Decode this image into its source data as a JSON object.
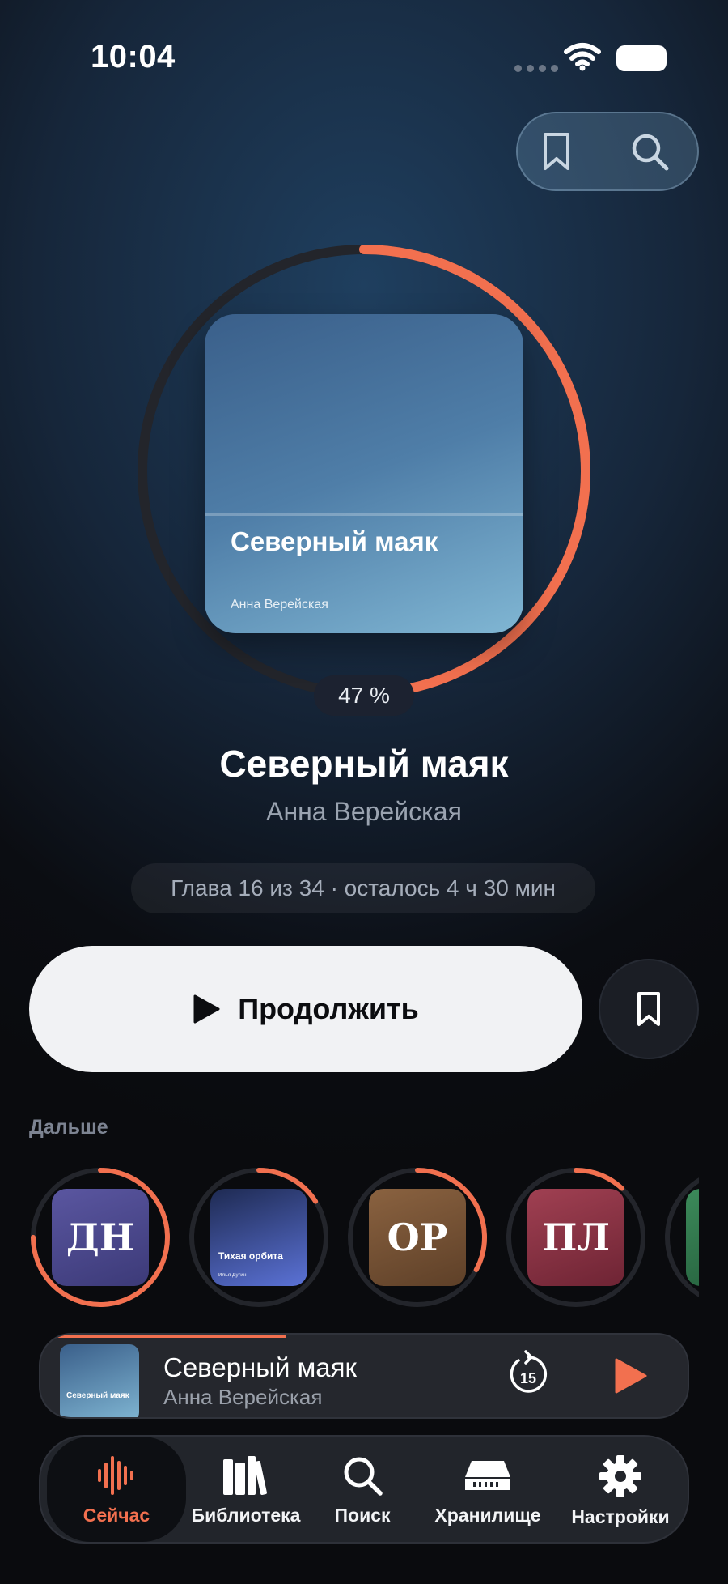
{
  "status_bar": {
    "time": "10:04"
  },
  "hero": {
    "cover_title": "Северный маяк",
    "cover_author": "Анна Верейская",
    "progress_label": "47 %",
    "progress": 0.47
  },
  "book": {
    "title": "Северный маяк",
    "author": "Анна Верейская",
    "chapter_info": "Глава 16 из 34 · осталось 4 ч 30 мин"
  },
  "actions": {
    "continue_label": "Продолжить"
  },
  "queue": {
    "label": "Дальше",
    "items": [
      {
        "initials": "ДН",
        "progress": 0.75,
        "color": "#4d4a8a"
      },
      {
        "title": "Тихая орбита",
        "author": "Илья Дугин",
        "progress": 0.16,
        "color": "#3d4f9a"
      },
      {
        "initials": "ОР",
        "progress": 0.33,
        "color": "#7a5536"
      },
      {
        "initials": "ПЛ",
        "progress": 0.12,
        "color": "#8a3345"
      }
    ]
  },
  "mini_player": {
    "title": "Северный маяк",
    "author": "Анна Верейская",
    "cover_title": "Северный маяк",
    "skip_label": "15",
    "progress": 0.38
  },
  "tabs": [
    {
      "label": "Сейчас",
      "icon": "waveform-icon",
      "active": true
    },
    {
      "label": "Библиотека",
      "icon": "books-icon",
      "active": false
    },
    {
      "label": "Поиск",
      "icon": "search-icon",
      "active": false
    },
    {
      "label": "Хранилище",
      "icon": "storage-icon",
      "active": false
    },
    {
      "label": "Настройки",
      "icon": "gear-icon",
      "active": false
    }
  ],
  "colors": {
    "accent": "#f2704f",
    "ring_track": "#23252b"
  }
}
